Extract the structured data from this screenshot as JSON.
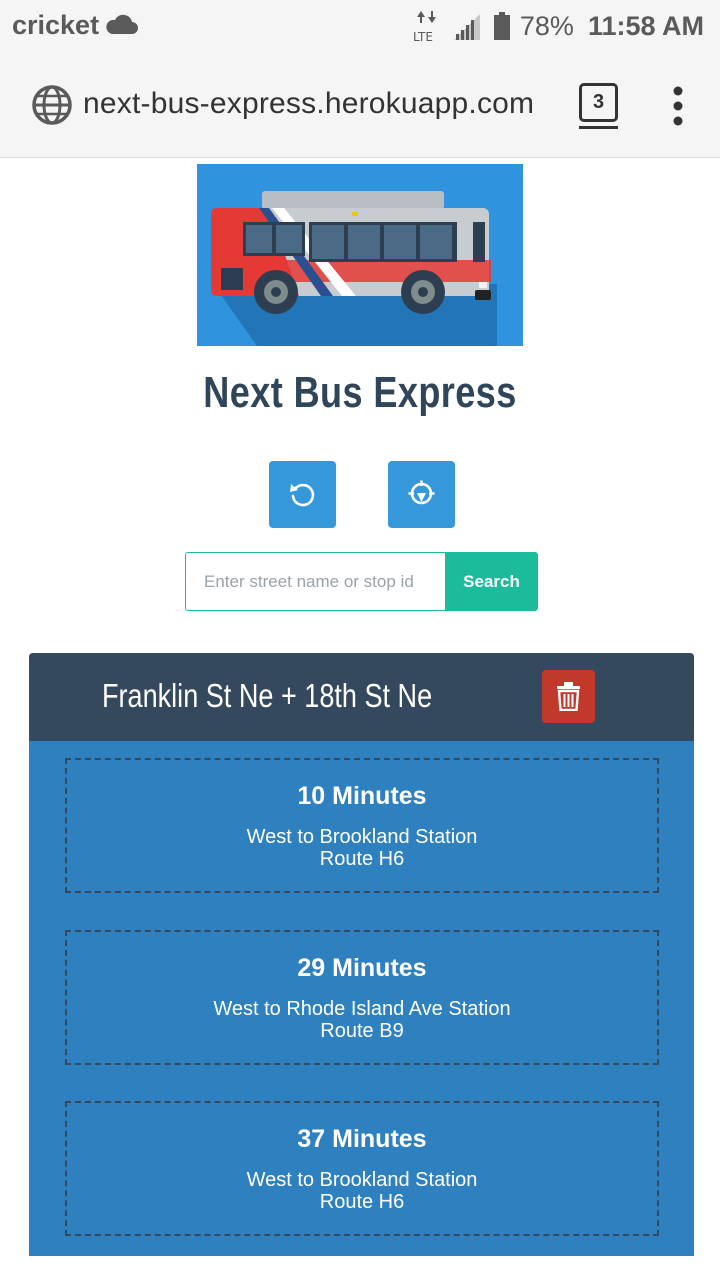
{
  "status_bar": {
    "carrier": "cricket",
    "network": "LTE",
    "battery": "78%",
    "time": "11:58 AM"
  },
  "browser": {
    "url": "next-bus-express.herokuapp.com",
    "tab_count": "3"
  },
  "app": {
    "title": "Next Bus Express"
  },
  "search": {
    "placeholder": "Enter street name or stop id",
    "button_label": "Search"
  },
  "colors": {
    "header_dark": "#34495e",
    "card_blue": "#2e80bf",
    "button_blue": "#3498db",
    "search_green": "#1abc9c",
    "delete_red": "#c0392b"
  },
  "stop": {
    "name": "Franklin St Ne + 18th St Ne",
    "arrivals": [
      {
        "minutes": "10 Minutes",
        "destination": "West to Brookland Station",
        "route": "Route H6"
      },
      {
        "minutes": "29 Minutes",
        "destination": "West to Rhode Island Ave Station",
        "route": "Route B9"
      },
      {
        "minutes": "37 Minutes",
        "destination": "West to Brookland Station",
        "route": "Route H6"
      }
    ]
  }
}
